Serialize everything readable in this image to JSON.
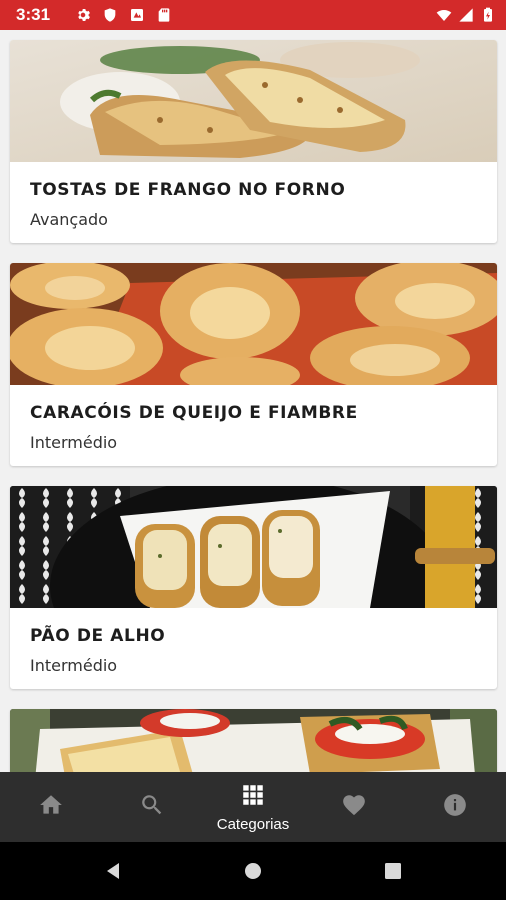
{
  "status_bar": {
    "time": "3:31",
    "left_icons": [
      "gear-icon",
      "shield-icon",
      "notification-icon",
      "sd-card-icon"
    ],
    "right_icons": [
      "wifi-icon",
      "signal-icon",
      "battery-icon"
    ],
    "color": "#d32a2a"
  },
  "recipes": [
    {
      "title": "TOSTAS DE FRANGO NO FORNO",
      "level": "Avançado",
      "image": "chicken-toast-photo"
    },
    {
      "title": "CARACÓIS DE QUEIJO E FIAMBRE",
      "level": "Intermédio",
      "image": "cheese-ham-pinwheels-photo"
    },
    {
      "title": "PÃO DE ALHO",
      "level": "Intermédio",
      "image": "garlic-bread-photo"
    },
    {
      "title": "",
      "level": "",
      "image": "bruschetta-photo"
    }
  ],
  "bottom_nav": {
    "items": [
      {
        "icon": "home-icon",
        "label": ""
      },
      {
        "icon": "search-icon",
        "label": ""
      },
      {
        "icon": "grid-icon",
        "label": "Categorias",
        "active": true
      },
      {
        "icon": "heart-icon",
        "label": ""
      },
      {
        "icon": "info-icon",
        "label": ""
      }
    ],
    "background": "#2e2e2e"
  },
  "system_nav": {
    "buttons": [
      "back-icon",
      "home-circle-icon",
      "recents-icon"
    ]
  }
}
